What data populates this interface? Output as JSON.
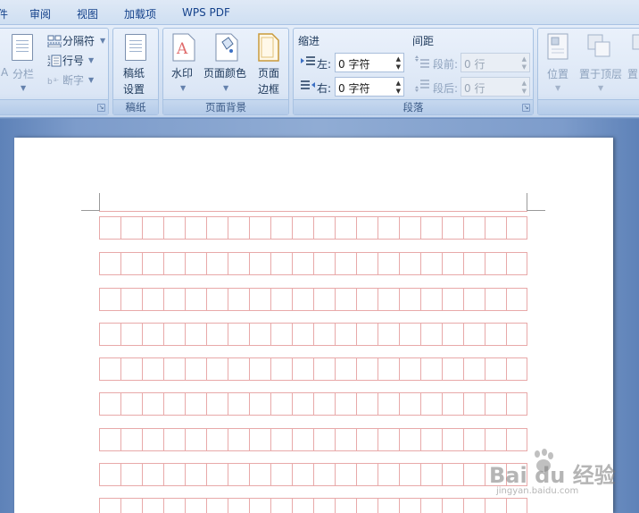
{
  "menu": {
    "tabs": [
      "件",
      "审阅",
      "视图",
      "加载项",
      "WPS PDF"
    ]
  },
  "ribbon": {
    "page_setup": {
      "columns_label": "分栏",
      "breaks_label": "分隔符",
      "line_numbers_label": "行号",
      "hyphenation_label": "断字",
      "partial_left": "A"
    },
    "draft": {
      "button_line1": "稿纸",
      "button_line2": "设置",
      "group_label": "稿纸"
    },
    "page_background": {
      "watermark_label": "水印",
      "page_color_label": "页面颜色",
      "page_border_line1": "页面",
      "page_border_line2": "边框",
      "group_label": "页面背景"
    },
    "paragraph": {
      "indent_header": "缩进",
      "spacing_header": "间距",
      "left_label": "左:",
      "right_label": "右:",
      "left_value": "0 字符",
      "right_value": "0 字符",
      "before_label": "段前:",
      "after_label": "段后:",
      "before_value": "0 行",
      "after_value": "0 行",
      "group_label": "段落"
    },
    "arrange": {
      "position_label": "位置",
      "bring_front_label": "置于顶层",
      "partial_label": "置"
    }
  },
  "watermark": {
    "brand": "Bai du 经验",
    "url": "jingyan.baidu.com"
  }
}
